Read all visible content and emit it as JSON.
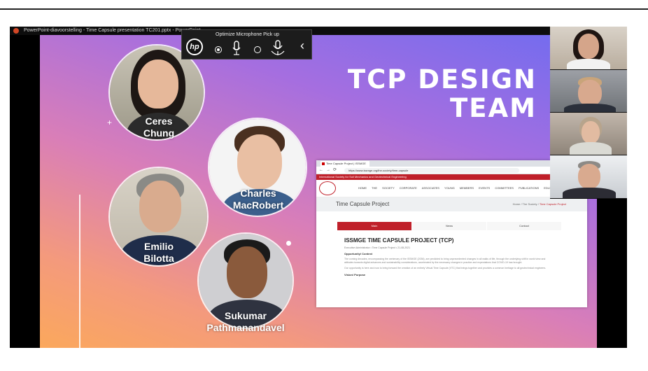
{
  "window": {
    "title": "PowerPoint-diavoorstelling  -  Time Capsule presentation TC201.pptx  -  PowerPoint",
    "icon": "powerpoint-icon"
  },
  "mic_toolbar": {
    "label": "Optimize Microphone Pick up",
    "brand": "hp",
    "options": [
      "mic-mode-single-icon",
      "mic-mode-room-icon"
    ],
    "selected_index": 0,
    "collapse_icon": "chevron-left-icon"
  },
  "slide": {
    "title_line1": "TCP DESIGN",
    "title_line2": "TEAM",
    "members": [
      {
        "first": "Ceres",
        "last": "Chung"
      },
      {
        "first": "Charles",
        "last": "MacRobert"
      },
      {
        "first": "Emilio",
        "last": "Bilotta"
      },
      {
        "first": "Sukumar",
        "last": "Pathmanandavel"
      }
    ]
  },
  "browser": {
    "tab_label": "Time Capsule Project | ISSMGE",
    "url": "https://www.issmge.org/the-society/time-capsule",
    "site_banner": "International Society for Soil Mechanics and Geotechnical Engineering",
    "login_label": "Log in",
    "menu_items": [
      "HOME",
      "THE SOCIETY",
      "CORPORATE ASSOCIATES",
      "YOUNG MEMBERS",
      "EVENTS",
      "COMMITTEES",
      "PUBLICATIONS",
      "EDUCATION",
      "FOUNDATION"
    ],
    "page_title": "Time Capsule Project",
    "breadcrumb": {
      "home": "Home",
      "society": "The Society",
      "current": "Time Capsule Project"
    },
    "tabs": [
      "Main",
      "News",
      "Contact"
    ],
    "active_tab": 0,
    "heading": "ISSMGE TIME CAPSULE PROJECT (TCP)",
    "meta": "Executive Administrator   •   Time Capsule Project   •   21-08-2021",
    "section1": "Opportunity/ Context",
    "para1": "The coming decades, encompassing the centenary of the ISSMGE (2036), are predicted to bring unprecedented changes in all walks of life, through the underlying shift in world view and attitudes towards digital advances and sustainability considerations, accelerated by the necessary changes in practice and expectations that COVID-19 has brought.",
    "para2": "Our opportunity is here and now to bring forward the creation of an entirely Virtual Time Capsule (VTC) that brings together and provides a common heritage to all geotechnical engineers.",
    "section2": "Vision/ Purpose"
  },
  "participants": [
    "participant-1",
    "participant-2",
    "participant-3",
    "participant-4"
  ],
  "colors": {
    "slide_gradient_start": "#6f6cf0",
    "slide_gradient_end": "#fba85c",
    "issmge_red": "#c0202a"
  }
}
